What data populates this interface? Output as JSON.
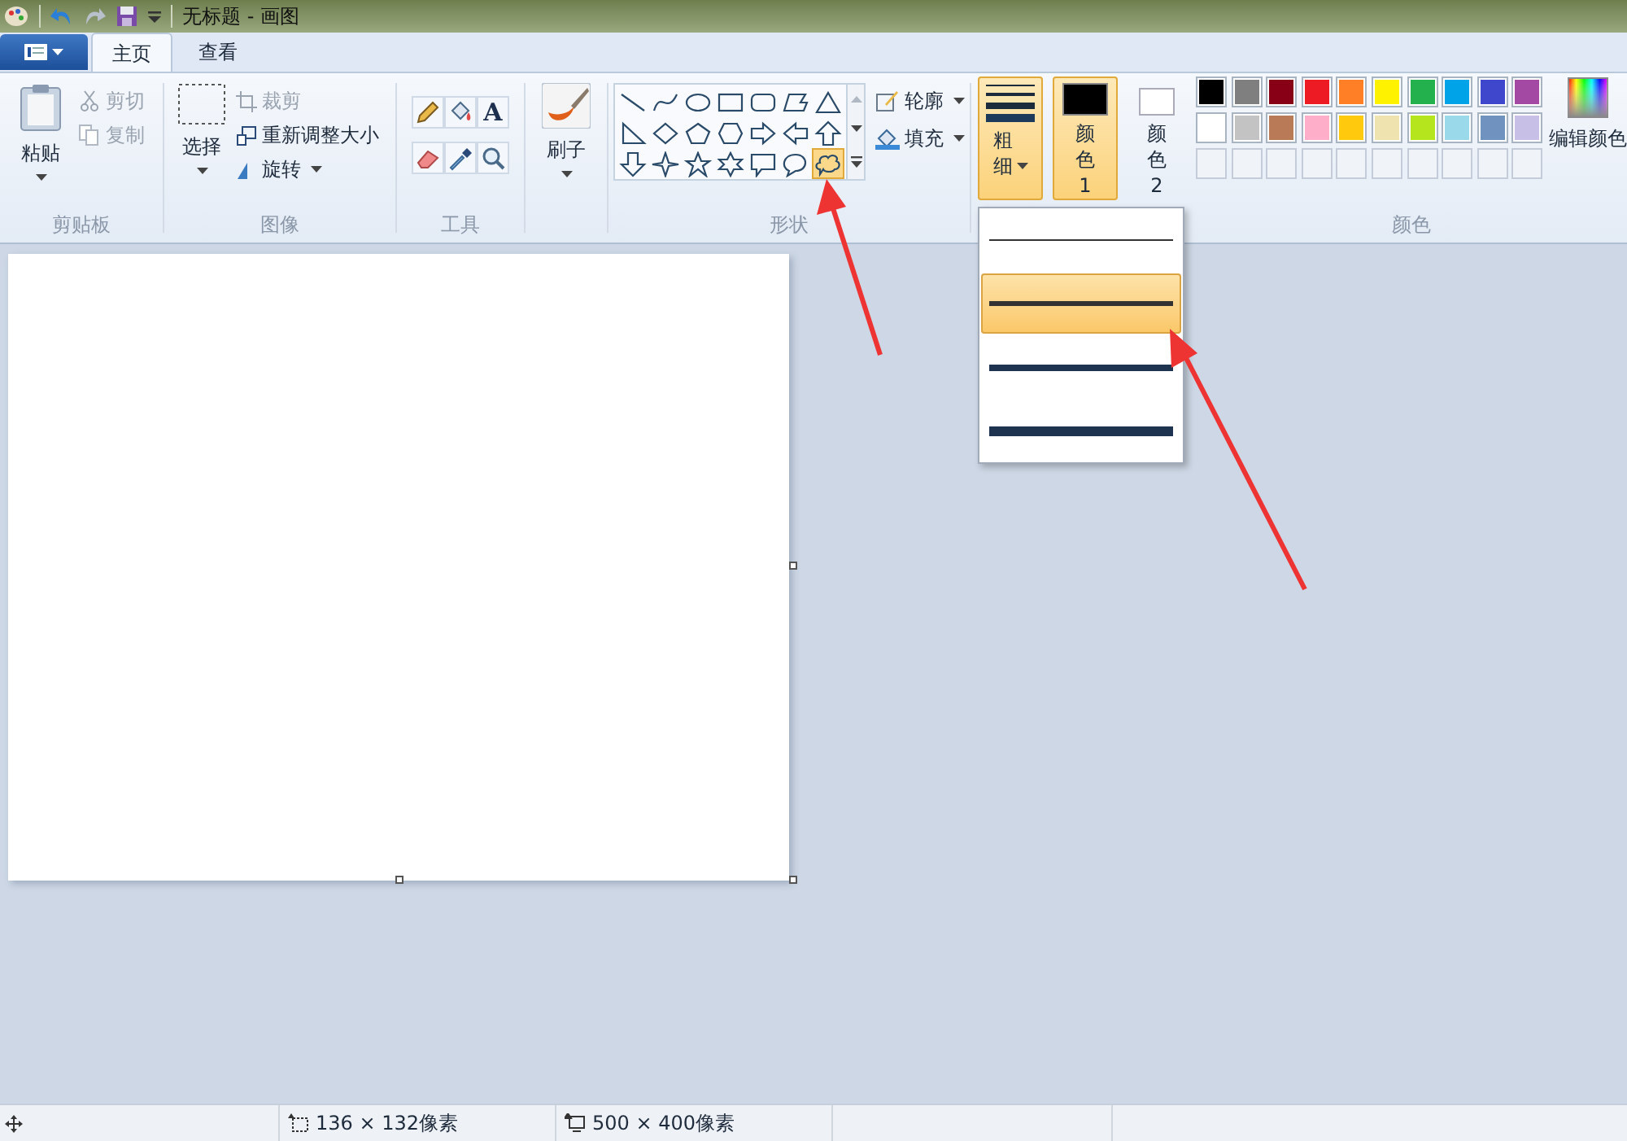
{
  "window": {
    "title": "无标题 - 画图"
  },
  "tabs": [
    {
      "label": "主页",
      "selected": true
    },
    {
      "label": "查看",
      "selected": false
    }
  ],
  "clipboard": {
    "paste": "粘贴",
    "cut": {
      "label": "剪切",
      "disabled": true
    },
    "copy": {
      "label": "复制",
      "disabled": true
    },
    "label": "剪贴板"
  },
  "image": {
    "select": "选择",
    "crop": {
      "label": "裁剪",
      "disabled": true
    },
    "resize": {
      "label": "重新调整大小",
      "disabled": false
    },
    "rotate": {
      "label": "旋转",
      "disabled": false
    },
    "label": "图像"
  },
  "tools": {
    "items": [
      {
        "kind": "pencil"
      },
      {
        "kind": "fill"
      },
      {
        "kind": "text",
        "label": "A"
      },
      {
        "kind": "eraser"
      },
      {
        "kind": "picker"
      },
      {
        "kind": "magnifier"
      }
    ],
    "label": "工具"
  },
  "brush": {
    "label": "刷子"
  },
  "shapes": {
    "items": [
      {
        "kind": "line",
        "selected": false
      },
      {
        "kind": "curve",
        "selected": false
      },
      {
        "kind": "oval",
        "selected": false
      },
      {
        "kind": "rect",
        "selected": false
      },
      {
        "kind": "roundrect",
        "selected": false
      },
      {
        "kind": "polygon",
        "selected": false
      },
      {
        "kind": "triangle",
        "selected": false
      },
      {
        "kind": "right-triangle",
        "selected": false
      },
      {
        "kind": "diamond",
        "selected": false
      },
      {
        "kind": "pentagon",
        "selected": false
      },
      {
        "kind": "hexagon",
        "selected": false
      },
      {
        "kind": "arrow-right",
        "selected": false
      },
      {
        "kind": "arrow-left",
        "selected": false
      },
      {
        "kind": "arrow-up",
        "selected": false
      },
      {
        "kind": "arrow-down",
        "selected": false
      },
      {
        "kind": "star4",
        "selected": false
      },
      {
        "kind": "star5",
        "selected": false
      },
      {
        "kind": "star6",
        "selected": false
      },
      {
        "kind": "callout-rect",
        "selected": false
      },
      {
        "kind": "callout-oval",
        "selected": false
      },
      {
        "kind": "callout-cloud",
        "selected": true
      }
    ],
    "outline": "轮廓",
    "fill": "填充",
    "label": "形状"
  },
  "size": {
    "label": "粗细",
    "options": [
      {
        "selected": false
      },
      {
        "selected": true
      },
      {
        "selected": false
      },
      {
        "selected": false
      }
    ]
  },
  "color1": {
    "label": "颜色 1",
    "color": "#000000",
    "selected": true
  },
  "color2": {
    "label": "颜色 2",
    "color": "#ffffff",
    "selected": false
  },
  "palette": {
    "colors": [
      {
        "color": "#000000"
      },
      {
        "color": "#7f7f7f"
      },
      {
        "color": "#880015"
      },
      {
        "color": "#ed1c24"
      },
      {
        "color": "#ff7f27"
      },
      {
        "color": "#fff200"
      },
      {
        "color": "#22b14c"
      },
      {
        "color": "#00a2e8"
      },
      {
        "color": "#3f48cc"
      },
      {
        "color": "#a349a4"
      },
      {
        "color": "#ffffff"
      },
      {
        "color": "#c3c3c3"
      },
      {
        "color": "#b97a57"
      },
      {
        "color": "#ffaec9"
      },
      {
        "color": "#ffc90e"
      },
      {
        "color": "#efe4b0"
      },
      {
        "color": "#b5e61d"
      },
      {
        "color": "#99d9ea"
      },
      {
        "color": "#7092be"
      },
      {
        "color": "#c8bfe7"
      }
    ],
    "edit": "编辑颜色",
    "label": "颜色"
  },
  "status_bar": {
    "selection_size": "136 × 132像素",
    "image_size": "500 × 400像素"
  }
}
